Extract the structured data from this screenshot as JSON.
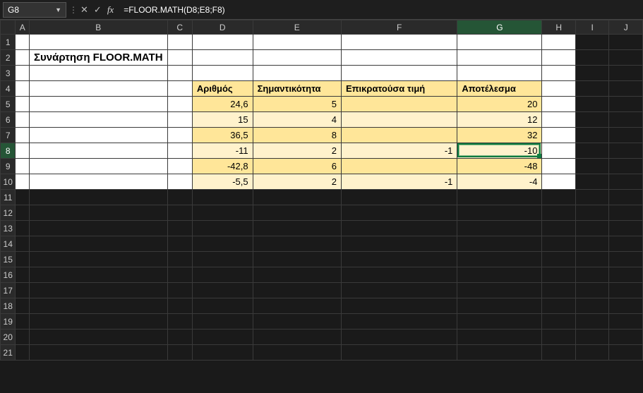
{
  "formula_bar": {
    "name_box": "G8",
    "formula": "=FLOOR.MATH(D8;E8;F8)"
  },
  "columns": [
    "A",
    "B",
    "C",
    "D",
    "E",
    "F",
    "G",
    "H",
    "I",
    "J"
  ],
  "rows": [
    "1",
    "2",
    "3",
    "4",
    "5",
    "6",
    "7",
    "8",
    "9",
    "10",
    "11",
    "12",
    "13",
    "14",
    "15",
    "16",
    "17",
    "18",
    "19",
    "20",
    "21"
  ],
  "selected_col": "G",
  "selected_row": "8",
  "title_cell": "Συνάρτηση FLOOR.MATH",
  "table": {
    "headers": {
      "D": "Αριθμός",
      "E": "Σημαντικότητα",
      "F": "Επικρατούσα τιμή",
      "G": "Αποτέλεσμα"
    },
    "rows": [
      {
        "D": "24,6",
        "E": "5",
        "F": "",
        "G": "20"
      },
      {
        "D": "15",
        "E": "4",
        "F": "",
        "G": "12"
      },
      {
        "D": "36,5",
        "E": "8",
        "F": "",
        "G": "32"
      },
      {
        "D": "-11",
        "E": "2",
        "F": "-1",
        "G": "-10"
      },
      {
        "D": "-42,8",
        "E": "6",
        "F": "",
        "G": "-48"
      },
      {
        "D": "-5,5",
        "E": "2",
        "F": "-1",
        "G": "-4"
      }
    ]
  },
  "chart_data": {
    "type": "table",
    "title": "Συνάρτηση FLOOR.MATH",
    "columns": [
      "Αριθμός",
      "Σημαντικότητα",
      "Επικρατούσα τιμή",
      "Αποτέλεσμα"
    ],
    "rows": [
      [
        24.6,
        5,
        null,
        20
      ],
      [
        15,
        4,
        null,
        12
      ],
      [
        36.5,
        8,
        null,
        32
      ],
      [
        -11,
        2,
        -1,
        -10
      ],
      [
        -42.8,
        6,
        null,
        -48
      ],
      [
        -5.5,
        2,
        -1,
        -4
      ]
    ]
  }
}
